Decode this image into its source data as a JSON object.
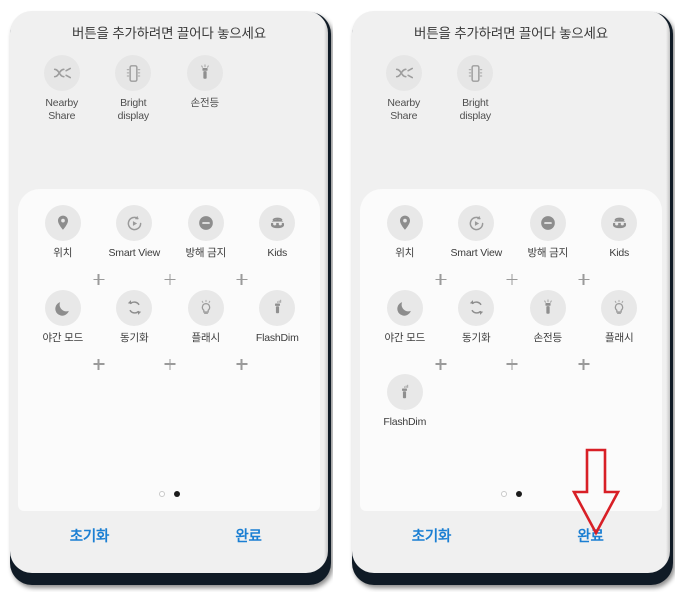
{
  "title": "버튼을 추가하려면 끌어다 놓으세요",
  "colors": {
    "accent_blue": "#1b7fd3",
    "annotation_red": "#d81f26",
    "bubble_gray": "#e4e4e4",
    "panel_bg": "#f0f0f0",
    "card_bg": "#fbfbfb",
    "device_edge": "#101b26"
  },
  "panels": [
    {
      "id": "before",
      "title": "버튼을 추가하려면 끌어다 놓으세요",
      "tray": [
        {
          "label": "Nearby\nShare",
          "icon": "nearby-share-icon"
        },
        {
          "label": "Bright\ndisplay",
          "icon": "bright-display-icon"
        },
        {
          "label": "손전등",
          "icon": "flashlight-icon"
        }
      ],
      "grid": [
        [
          {
            "label": "위치",
            "icon": "location-pin-icon"
          },
          {
            "label": "Smart View",
            "icon": "smart-view-icon"
          },
          {
            "label": "방해 금지",
            "icon": "do-not-disturb-icon"
          },
          {
            "label": "Kids",
            "icon": "kids-mode-icon"
          }
        ],
        [
          {
            "label": "야간 모드",
            "icon": "night-mode-icon"
          },
          {
            "label": "동기화",
            "icon": "sync-icon"
          },
          {
            "label": "플래시",
            "icon": "flash-bulb-icon"
          },
          {
            "label": "FlashDim",
            "icon": "flashdim-icon"
          }
        ]
      ],
      "page_dots": [
        {
          "state": "inactive"
        },
        {
          "state": "active"
        }
      ],
      "actions": {
        "reset_label": "초기화",
        "done_label": "완료"
      }
    },
    {
      "id": "after",
      "title": "버튼을 추가하려면 끌어다 놓으세요",
      "tray": [
        {
          "label": "Nearby\nShare",
          "icon": "nearby-share-icon"
        },
        {
          "label": "Bright\ndisplay",
          "icon": "bright-display-icon"
        }
      ],
      "grid": [
        [
          {
            "label": "위치",
            "icon": "location-pin-icon"
          },
          {
            "label": "Smart View",
            "icon": "smart-view-icon"
          },
          {
            "label": "방해 금지",
            "icon": "do-not-disturb-icon"
          },
          {
            "label": "Kids",
            "icon": "kids-mode-icon"
          }
        ],
        [
          {
            "label": "야간 모드",
            "icon": "night-mode-icon"
          },
          {
            "label": "동기화",
            "icon": "sync-icon"
          },
          {
            "label": "손전등",
            "icon": "flashlight-icon"
          },
          {
            "label": "플래시",
            "icon": "flash-bulb-icon"
          }
        ],
        [
          {
            "label": "FlashDim",
            "icon": "flashdim-icon"
          }
        ]
      ],
      "page_dots": [
        {
          "state": "inactive"
        },
        {
          "state": "active"
        }
      ],
      "actions": {
        "reset_label": "초기화",
        "done_label": "완료"
      },
      "annotation": {
        "type": "arrow-down",
        "points_at": "완료",
        "color": "#d81f26"
      }
    }
  ]
}
